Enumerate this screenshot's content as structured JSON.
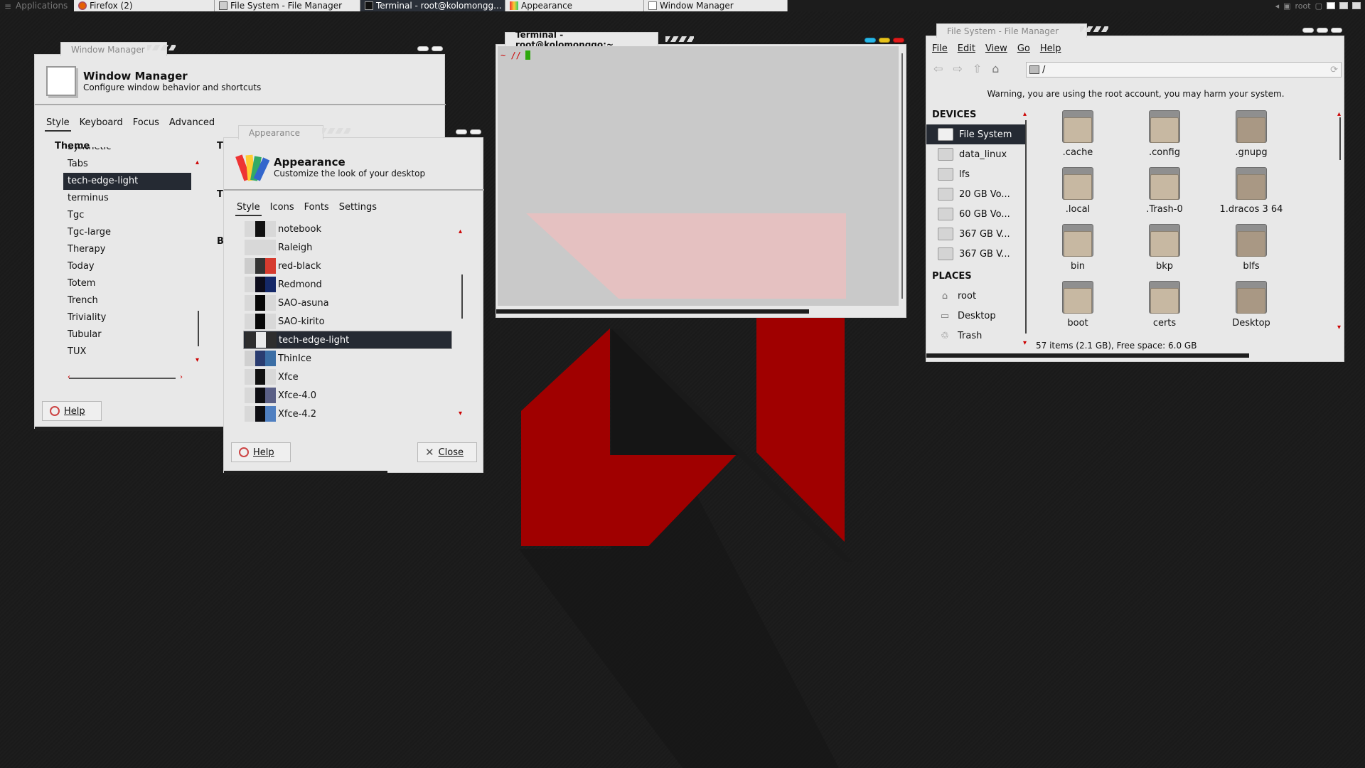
{
  "taskbar": {
    "apps_label": "Applications",
    "tasks": [
      {
        "label": "Firefox (2)"
      },
      {
        "label": "File System - File Manager"
      },
      {
        "label": "Terminal - root@kolomongg..."
      },
      {
        "label": "Appearance"
      },
      {
        "label": "Window Manager"
      }
    ],
    "user": "root"
  },
  "window_manager": {
    "title": "Window Manager",
    "header_title": "Window Manager",
    "header_sub": "Configure window behavior and shortcuts",
    "tabs": [
      "Style",
      "Keyboard",
      "Focus",
      "Advanced"
    ],
    "theme_label": "Theme",
    "title_font_partial": "Ti",
    "title_align_partial": "Ti",
    "button_layout_partial": "B",
    "themes": [
      "Synthetic",
      "Tabs",
      "tech-edge-light",
      "terminus",
      "Tgc",
      "Tgc-large",
      "Therapy",
      "Today",
      "Totem",
      "Trench",
      "Triviality",
      "Tubular",
      "TUX"
    ],
    "selected_theme": "tech-edge-light",
    "help": "Help"
  },
  "appearance": {
    "title": "Appearance",
    "header_title": "Appearance",
    "header_sub": "Customize the look of your desktop",
    "tabs": [
      "Style",
      "Icons",
      "Fonts",
      "Settings"
    ],
    "themes": [
      {
        "name": "notebook",
        "colors": [
          "#d8d8d8",
          "#111111",
          "#d8d8d8"
        ]
      },
      {
        "name": "Raleigh",
        "colors": [
          "#d8d8d8",
          "#d8d8d8",
          "#d8d8d8"
        ]
      },
      {
        "name": "red-black",
        "colors": [
          "#cccccc",
          "#333333",
          "#d63b2f"
        ]
      },
      {
        "name": "Redmond",
        "colors": [
          "#d8d8d8",
          "#0c0c1c",
          "#142868"
        ]
      },
      {
        "name": "SAO-asuna",
        "colors": [
          "#d8d8d8",
          "#080808",
          "#d8d8d8"
        ]
      },
      {
        "name": "SAO-kirito",
        "colors": [
          "#d8d8d8",
          "#080808",
          "#d8d8d8"
        ]
      },
      {
        "name": "tech-edge-light",
        "colors": [
          "#2e2e2e",
          "#eaeaea",
          "#2e2e2e"
        ]
      },
      {
        "name": "ThinIce",
        "colors": [
          "#d0d0d0",
          "#2a3c70",
          "#3b6ea5"
        ]
      },
      {
        "name": "Xfce",
        "colors": [
          "#d8d8d8",
          "#111111",
          "#d8d8d8"
        ]
      },
      {
        "name": "Xfce-4.0",
        "colors": [
          "#d8d8d8",
          "#0d0d12",
          "#5a5f86"
        ]
      },
      {
        "name": "Xfce-4.2",
        "colors": [
          "#d8d8d8",
          "#0d0d12",
          "#4f7fc1"
        ]
      }
    ],
    "selected_theme": "tech-edge-light",
    "help": "Help",
    "close": "Close"
  },
  "terminal": {
    "title": "Terminal - root@kolomonggo:~",
    "prompt": "~ //"
  },
  "file_manager": {
    "title": "File System - File Manager",
    "menu": [
      "File",
      "Edit",
      "View",
      "Go",
      "Help"
    ],
    "path": "/",
    "warning": "Warning, you are using the root account, you may harm your system.",
    "devices_label": "DEVICES",
    "devices": [
      "File System",
      "data_linux",
      "lfs",
      "20 GB Vo...",
      "60 GB Vo...",
      "367 GB V...",
      "367 GB V..."
    ],
    "places_label": "PLACES",
    "places": [
      {
        "label": "root",
        "icon": "home-icon"
      },
      {
        "label": "Desktop",
        "icon": "desktop-icon"
      },
      {
        "label": "Trash",
        "icon": "trash-icon"
      }
    ],
    "files": [
      ".cache",
      ".config",
      ".gnupg",
      ".local",
      ".Trash-0",
      "1.dracos 3 64",
      "bin",
      "bkp",
      "blfs",
      "boot",
      "certs",
      "Desktop"
    ],
    "status": "57 items (2.1 GB), Free space: 6.0 GB"
  },
  "colors": {
    "accent_dark": "#252a33",
    "wallpaper_red": "#a00000"
  }
}
